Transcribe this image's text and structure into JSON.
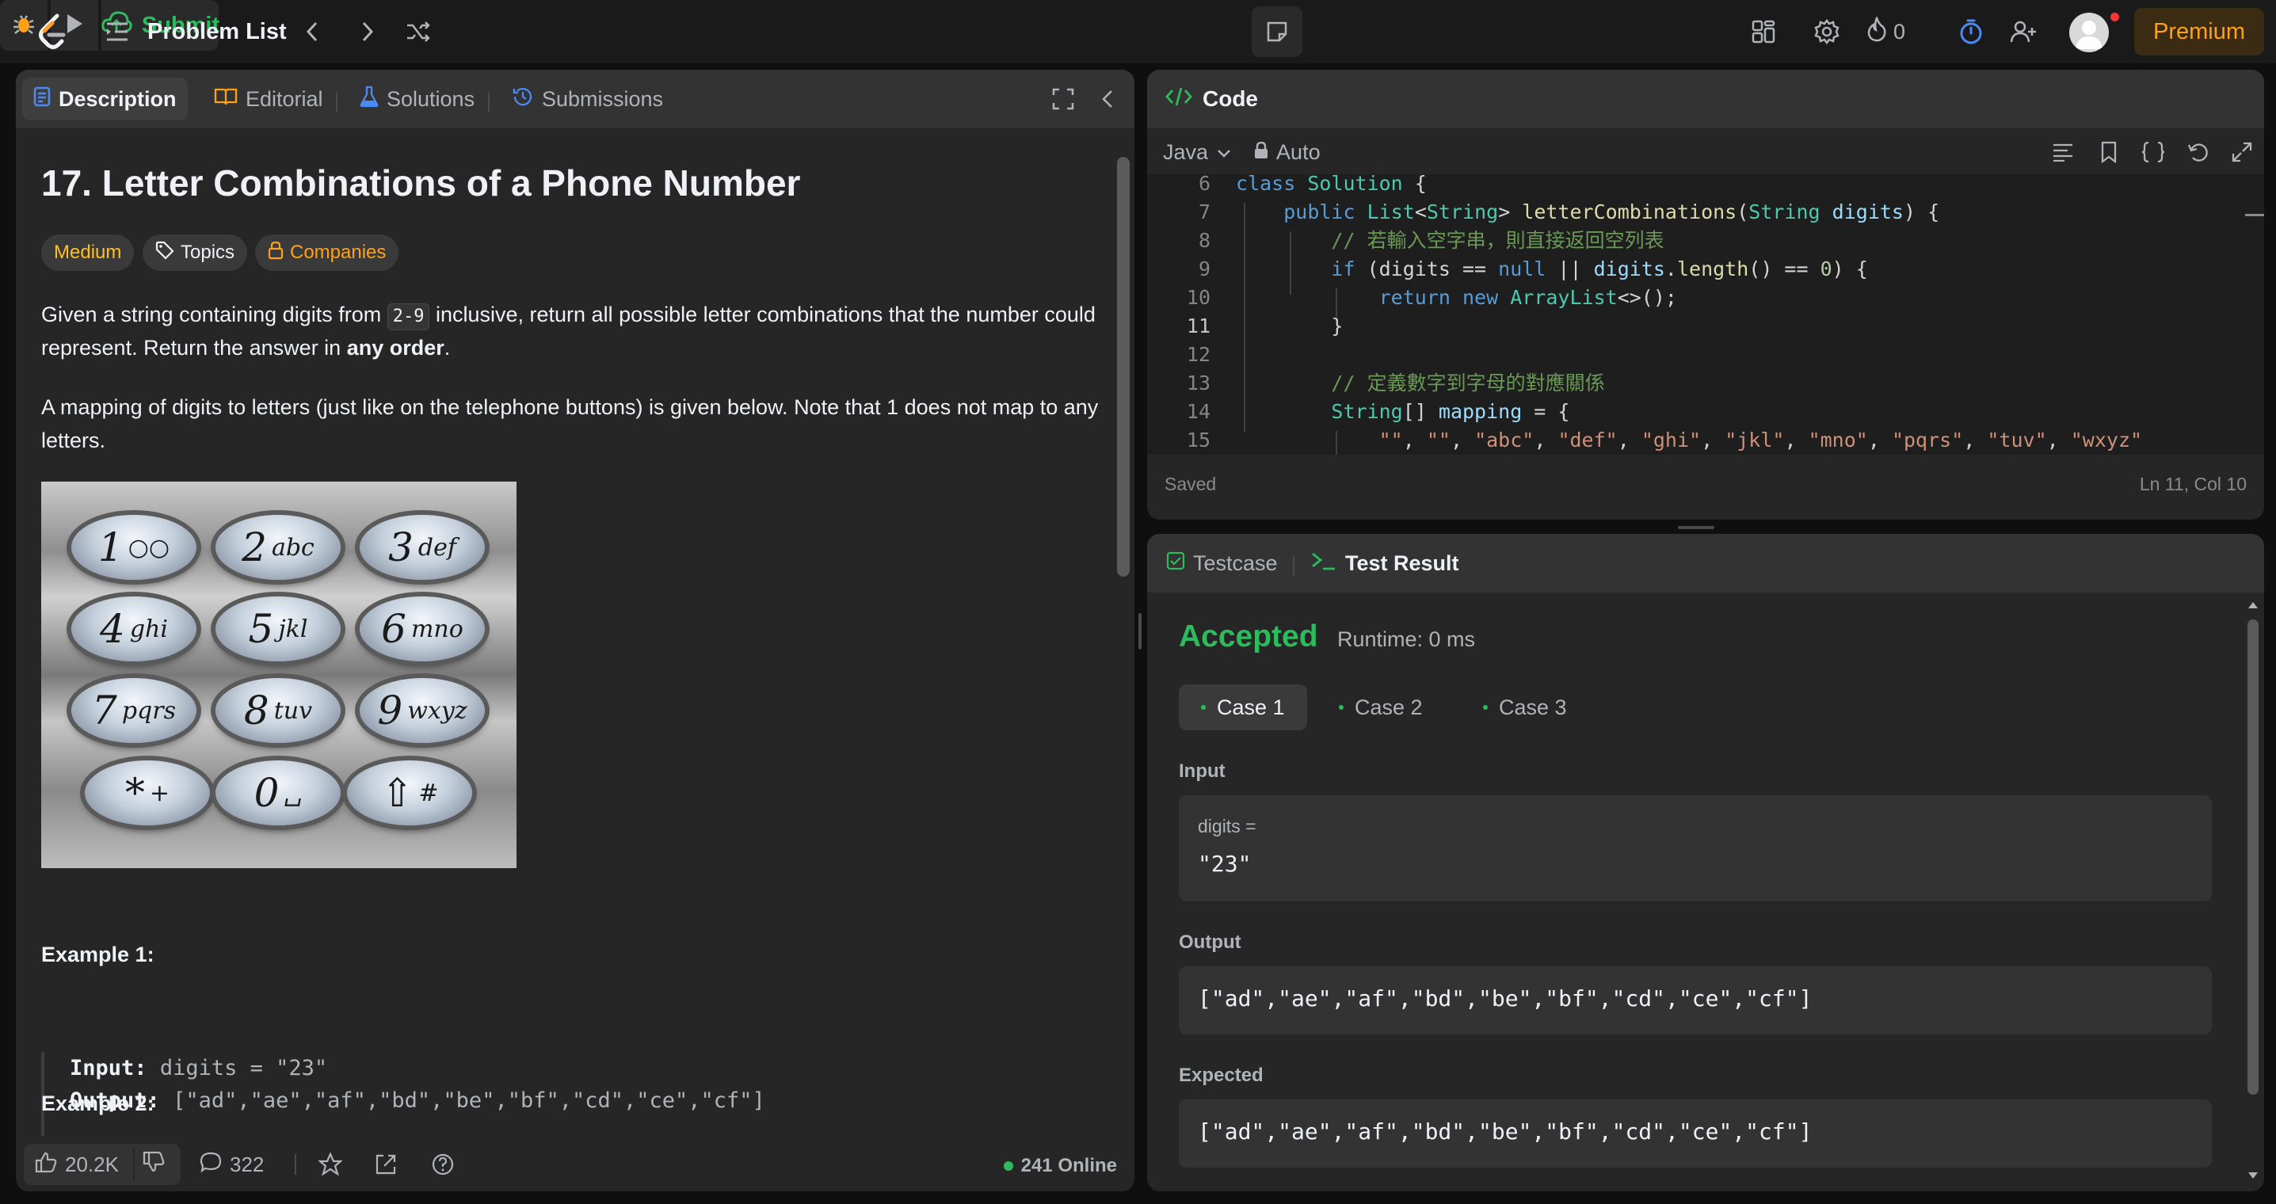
{
  "topbar": {
    "title": "Problem List",
    "submit_label": "Submit",
    "streak_count": "0",
    "premium_label": "Premium"
  },
  "left": {
    "tabs": [
      "Description",
      "Editorial",
      "Solutions",
      "Submissions"
    ],
    "title": "17. Letter Combinations of a Phone Number",
    "difficulty": "Medium",
    "topics": "Topics",
    "companies": "Companies",
    "p1_a": "Given a string containing digits from ",
    "p1_code": "2-9",
    "p1_b": " inclusive, return all possible letter combinations that the number could represent. Return the answer in ",
    "p1_bold": "any order",
    "p1_c": ".",
    "p2": "A mapping of digits to letters (just like on the telephone buttons) is given below. Note that 1 does not map to any letters.",
    "keypad": [
      {
        "d": "1",
        "l": "○○"
      },
      {
        "d": "2",
        "l": "abc"
      },
      {
        "d": "3",
        "l": "def"
      },
      {
        "d": "4",
        "l": "ghi"
      },
      {
        "d": "5",
        "l": "jkl"
      },
      {
        "d": "6",
        "l": "mno"
      },
      {
        "d": "7",
        "l": "pqrs"
      },
      {
        "d": "8",
        "l": "tuv"
      },
      {
        "d": "9",
        "l": "wxyz"
      },
      {
        "d": "*",
        "l": "+"
      },
      {
        "d": "0",
        "l": "␣"
      },
      {
        "d": "⇧",
        "l": "#"
      }
    ],
    "example1_title": "Example 1:",
    "example1_input_label": "Input:",
    "example1_input": "digits = \"23\"",
    "example1_output_label": "Output:",
    "example1_output": "[\"ad\",\"ae\",\"af\",\"bd\",\"be\",\"bf\",\"cd\",\"ce\",\"cf\"]",
    "example2_title": "Example 2:",
    "likes": "20.2K",
    "comments": "322",
    "online": "241 Online"
  },
  "code": {
    "title": "Code",
    "language": "Java",
    "mode": "Auto",
    "status": "Saved",
    "cursor": "Ln 11, Col 10",
    "current_line": "11"
  },
  "result": {
    "tabs": [
      "Testcase",
      "Test Result"
    ],
    "status": "Accepted",
    "runtime": "Runtime: 0 ms",
    "cases": [
      "Case 1",
      "Case 2",
      "Case 3"
    ],
    "input_label": "Input",
    "var_name": "digits =",
    "var_value": "\"23\"",
    "output_label": "Output",
    "output_value": "[\"ad\",\"ae\",\"af\",\"bd\",\"be\",\"bf\",\"cd\",\"ce\",\"cf\"]",
    "expected_label": "Expected",
    "expected_value": "[\"ad\",\"ae\",\"af\",\"bd\",\"be\",\"bf\",\"cd\",\"ce\",\"cf\"]"
  },
  "colors": {
    "accent": "#ffa116",
    "success": "#2cbb5d",
    "link_blue": "#4c8bf5"
  },
  "icons": [
    "leetcode-logo-icon",
    "problem-list-icon",
    "prev-icon",
    "next-icon",
    "shuffle-icon",
    "debug-icon",
    "play-icon",
    "upload-cloud-icon",
    "note-icon",
    "layout-icon",
    "gear-icon",
    "fire-icon",
    "timer-icon",
    "add-user-icon",
    "avatar",
    "expand-icon",
    "collapse-icon",
    "tag-icon",
    "lock-icon",
    "thumbs-up-icon",
    "thumbs-down-icon",
    "comment-icon",
    "star-icon",
    "share-icon",
    "help-icon"
  ]
}
